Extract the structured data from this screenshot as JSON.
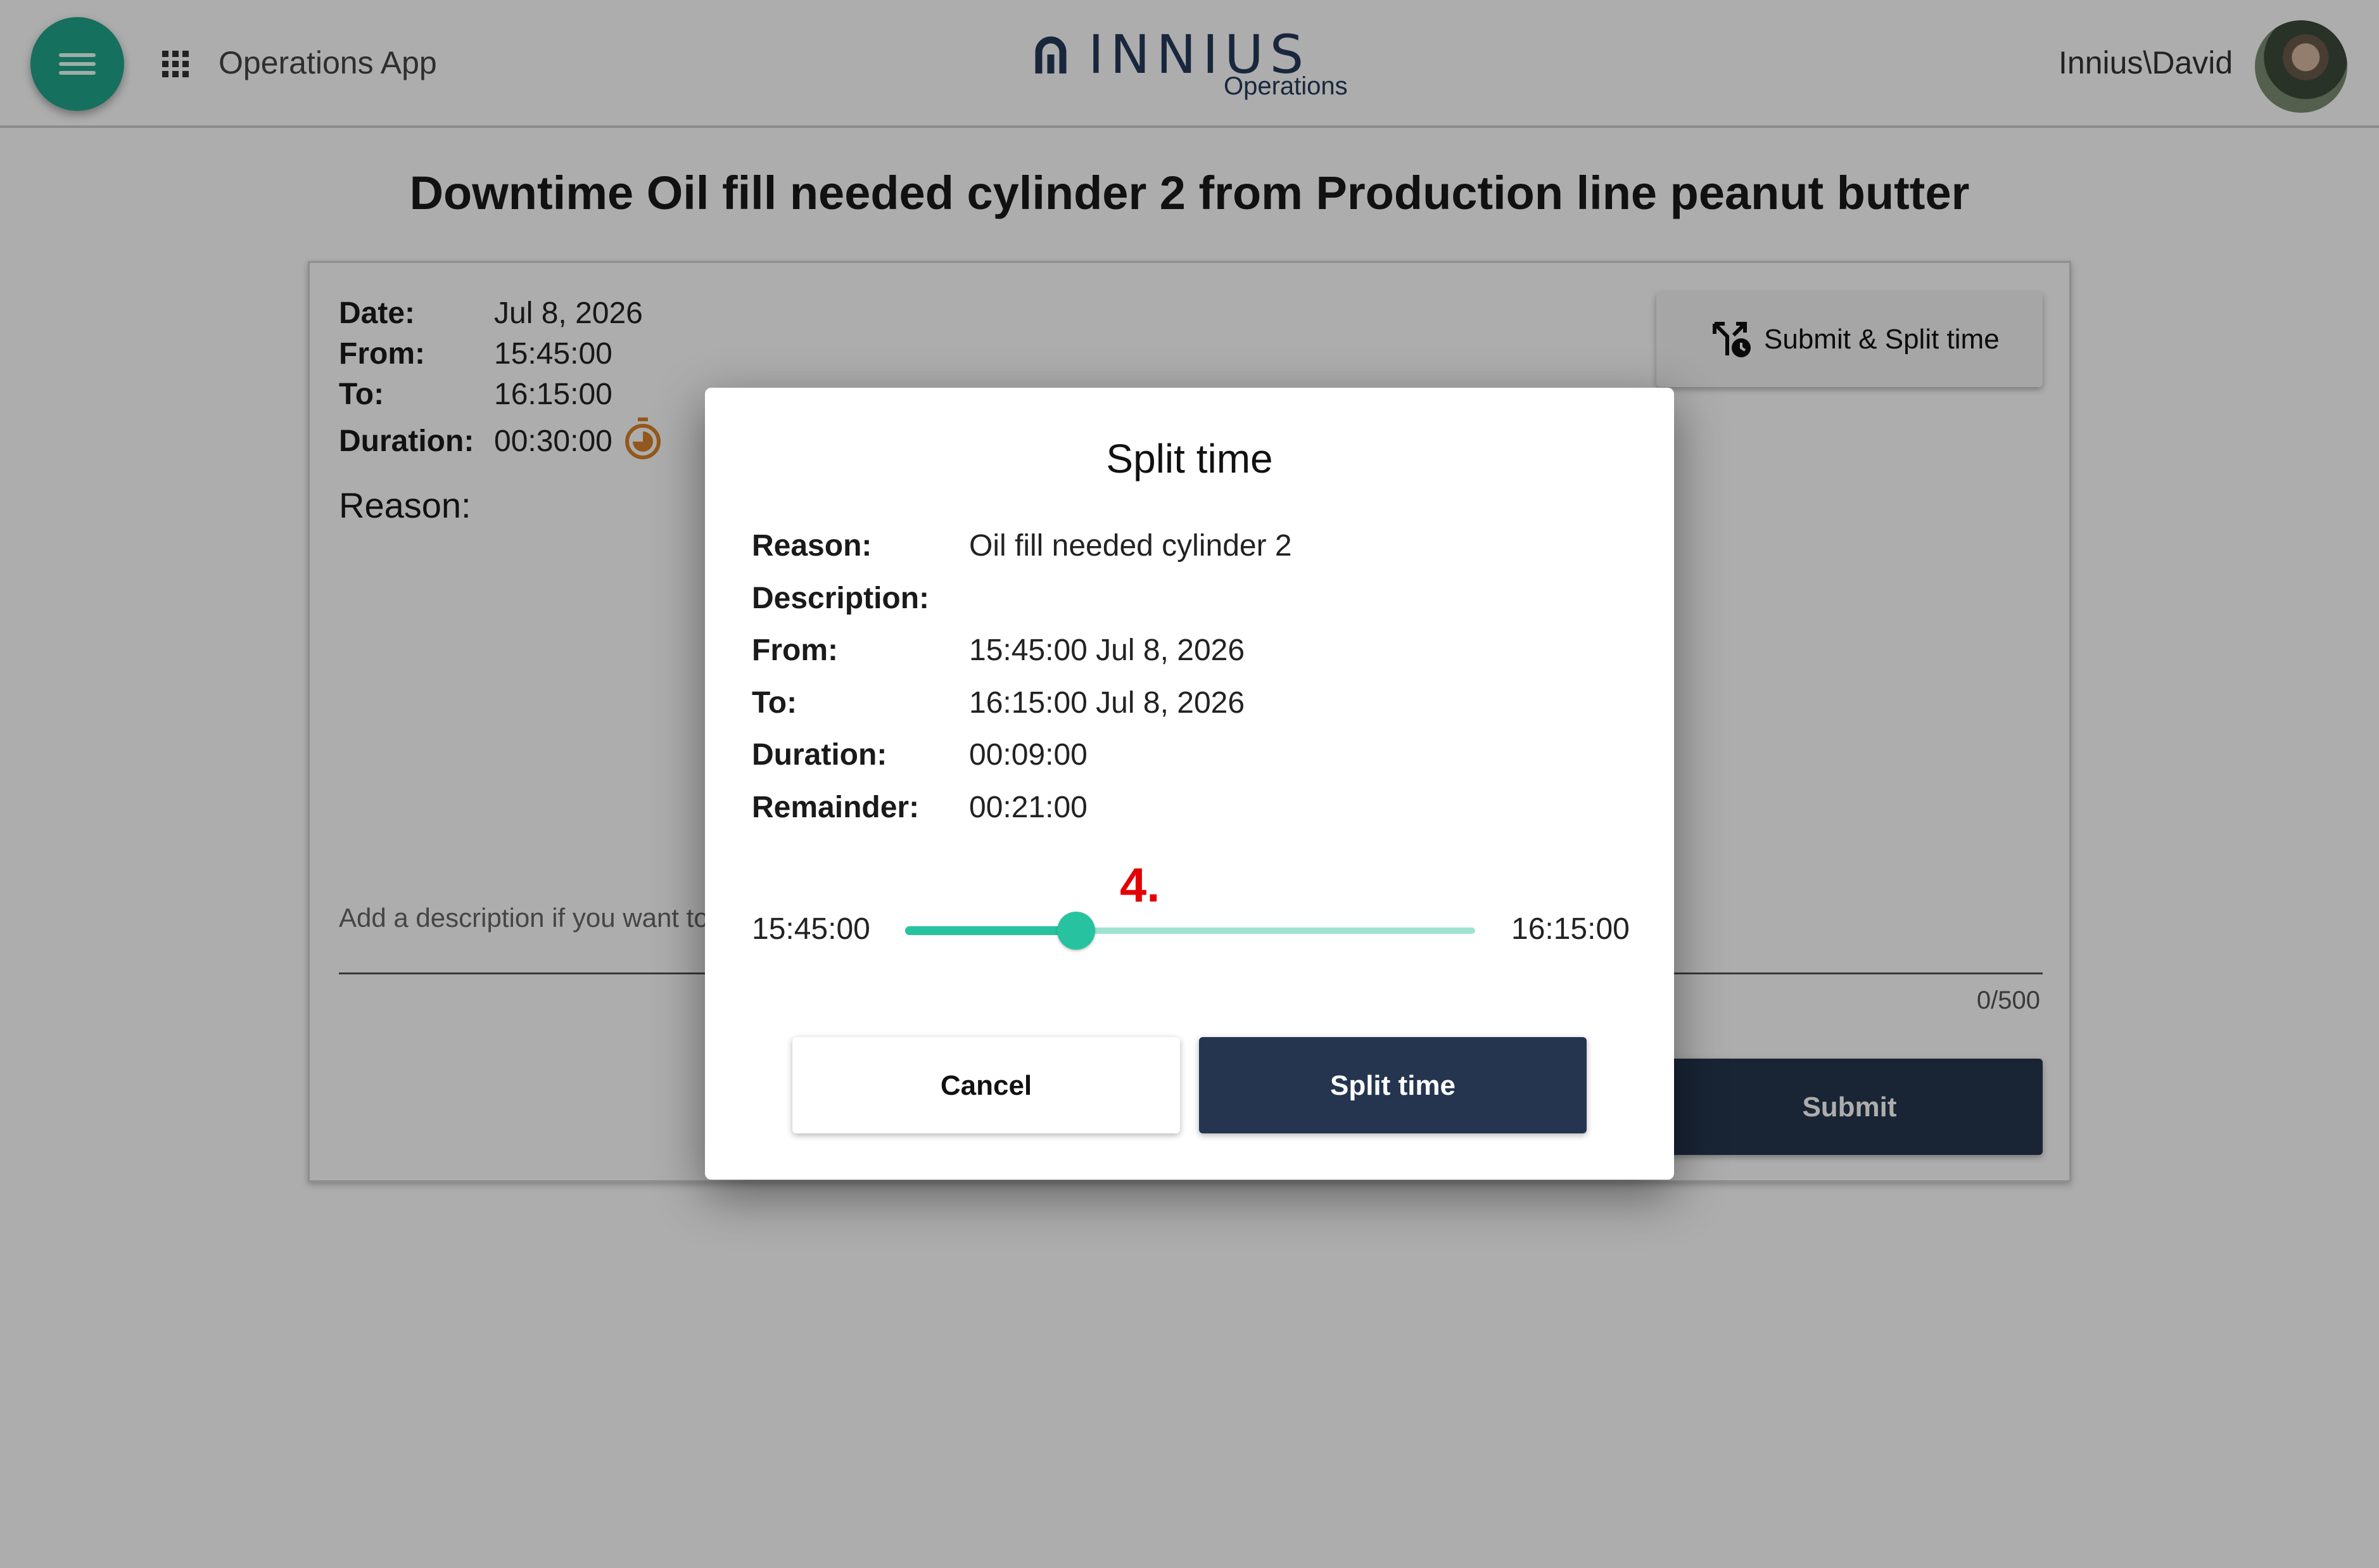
{
  "app_bar": {
    "app_name": "Operations App",
    "logo_word": "INNIUS",
    "logo_subtitle": "Operations",
    "user": "Innius\\David",
    "brand_color": "#1fa58a"
  },
  "page": {
    "title": "Downtime Oil fill needed cylinder 2 from Production line peanut butter",
    "details": {
      "date_label": "Date:",
      "date": "Jul 8, 2026",
      "from_label": "From:",
      "from": "15:45:00",
      "to_label": "To:",
      "to": "16:15:00",
      "duration_label": "Duration:",
      "duration": "00:30:00"
    },
    "reason_label": "Reason:",
    "description_placeholder": "Add a description if you want to",
    "char_counter": "0/500",
    "submit_split_label": "Submit & Split time",
    "submit_label": "Submit"
  },
  "dialog": {
    "title": "Split time",
    "rows": [
      {
        "label": "Reason:",
        "value": "Oil fill needed cylinder 2"
      },
      {
        "label": "Description:",
        "value": ""
      },
      {
        "label": "From:",
        "value": "15:45:00 Jul 8, 2026"
      },
      {
        "label": "To:",
        "value": "16:15:00 Jul 8, 2026"
      },
      {
        "label": "Duration:",
        "value": "00:09:00"
      },
      {
        "label": "Remainder:",
        "value": "00:21:00"
      }
    ],
    "slider": {
      "start_label": "15:45:00",
      "end_label": "16:15:00",
      "value_fraction": 0.3
    },
    "step_marker": "4.",
    "cancel_label": "Cancel",
    "confirm_label": "Split time",
    "accent_color": "#27c3a0",
    "primary_button_color": "#25354f",
    "marker_color": "#e40000"
  }
}
